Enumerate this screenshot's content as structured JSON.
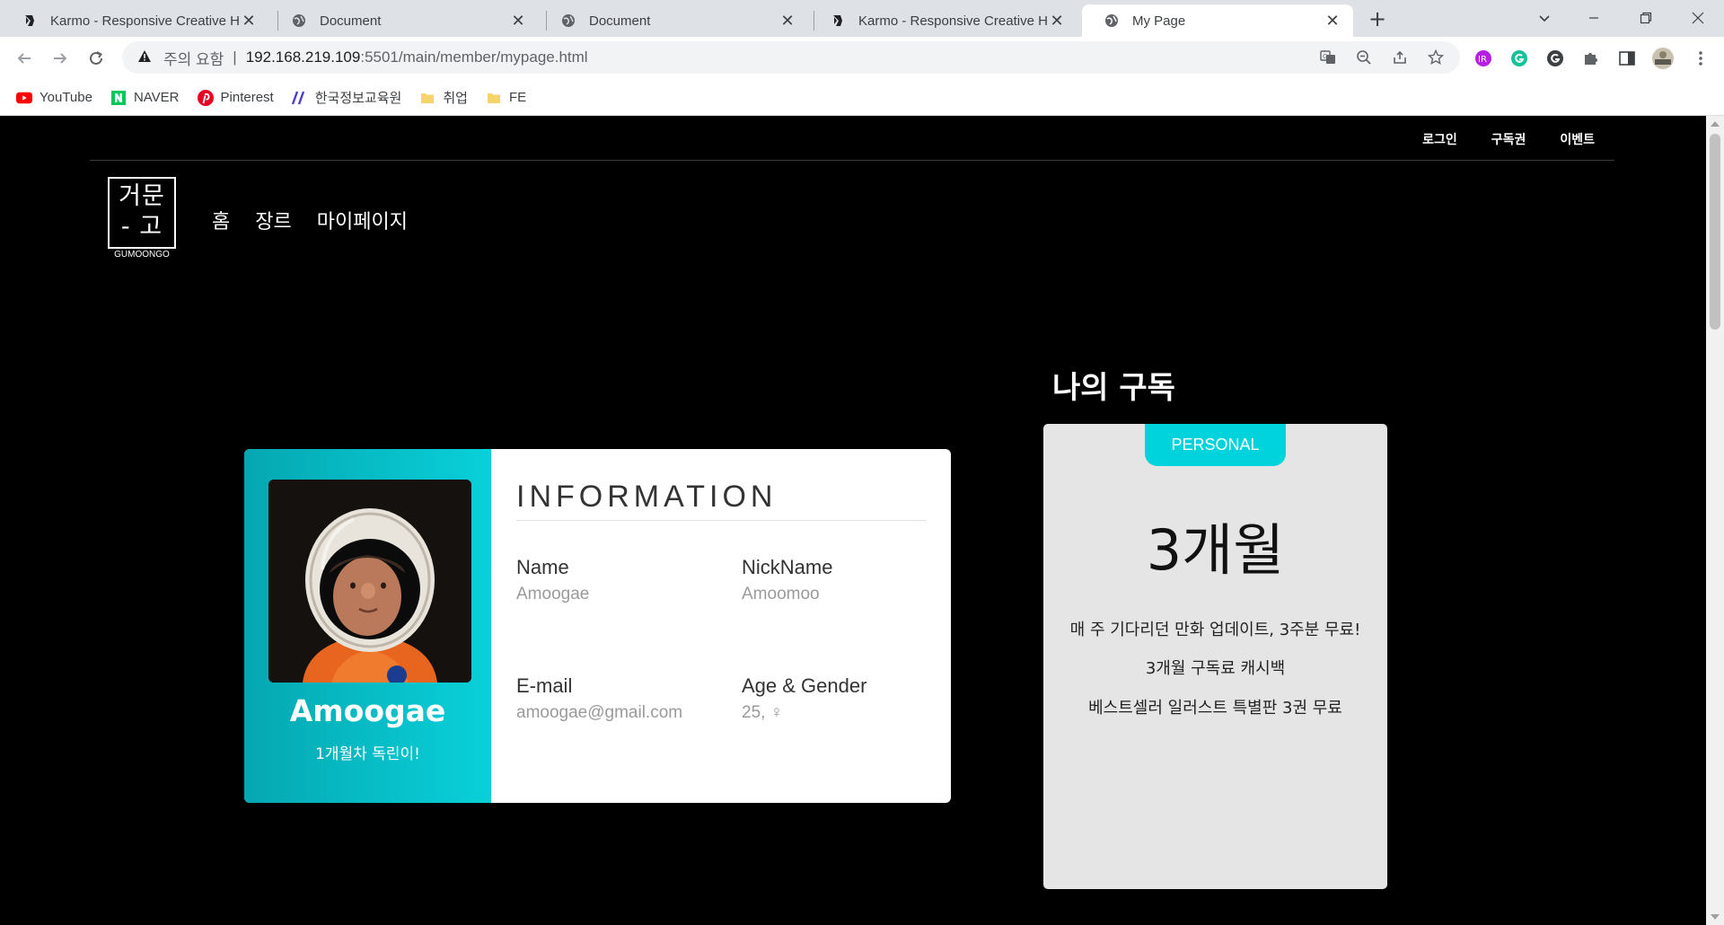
{
  "browser": {
    "tabs": [
      {
        "title": "Karmo - Responsive Creative HTML",
        "favicon": "karmo-icon",
        "active": false
      },
      {
        "title": "Document",
        "favicon": "globe-icon",
        "active": false
      },
      {
        "title": "Document",
        "favicon": "globe-icon",
        "active": false
      },
      {
        "title": "Karmo - Responsive Creative HTML",
        "favicon": "karmo-icon",
        "active": false
      },
      {
        "title": "My Page",
        "favicon": "globe-icon",
        "active": true
      }
    ],
    "new_tab_label": "+",
    "address": {
      "security_label": "주의 요함",
      "separator": "|",
      "host": "192.168.219.109",
      "path": ":5501/main/member/mypage.html"
    },
    "bookmarks": [
      {
        "label": "YouTube",
        "icon": "youtube-icon"
      },
      {
        "label": "NAVER",
        "icon": "naver-icon"
      },
      {
        "label": "Pinterest",
        "icon": "pinterest-icon"
      },
      {
        "label": "한국정보교육원",
        "icon": "slashes-icon"
      },
      {
        "label": "취업",
        "icon": "folder-icon"
      },
      {
        "label": "FE",
        "icon": "folder-icon"
      }
    ]
  },
  "site": {
    "top_nav": [
      "로그인",
      "구독권",
      "이벤트"
    ],
    "logo": {
      "line1": "거문",
      "line2": "- 고",
      "sub": "GUMOONGO"
    },
    "main_nav": [
      "홈",
      "장르",
      "마이페이지"
    ]
  },
  "profile": {
    "name": "Amoogae",
    "subtitle": "1개월차 독린이!",
    "section_title": "INFORMATION",
    "fields": [
      {
        "label": "Name",
        "value": "Amoogae"
      },
      {
        "label": "NickName",
        "value": "Amoomoo"
      },
      {
        "label": "E-mail",
        "value": "amoogae@gmail.com"
      },
      {
        "label": "Age & Gender",
        "value": "25, ♀"
      }
    ]
  },
  "subscription": {
    "title": "나의 구독",
    "badge": "PERSONAL",
    "period": "3개월",
    "benefits": [
      "매 주 기다리던 만화 업데이트, 3주분 무료!",
      "3개월 구독료 캐시백",
      "베스트셀러 일러스트 특별판 3권 무료"
    ]
  },
  "colors": {
    "accent": "#00d3dc",
    "gradient_start": "#05a7b1",
    "page_background": "#000000",
    "card_background": "#e5e5e5"
  }
}
